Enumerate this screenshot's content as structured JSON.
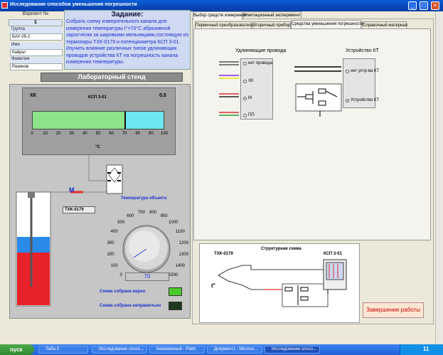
{
  "window": {
    "title": "Исследование способов уменьшения погрешности"
  },
  "student": {
    "variant_label": "Вариант №",
    "variant_value": "1",
    "group_label": "Группа",
    "group_value": "БАУ-05-2",
    "name_label": "Имя",
    "name_value": "Кайрат",
    "surname_label": "Фамилия",
    "surname_value": "Разинов"
  },
  "task": {
    "title": "Задание:",
    "text": "Собрать схему измерительного канала для измерения температуры t°=70°C абразивной заросчески за шаровыми мельницами,состоящую из термопары ТХК-0179 и потенциометра КСП 3-01. Изучить влияние различных типов удлиняющих проводов устройства КТ на погрешность канала измерения температуры."
  },
  "lab": {
    "title": "Лабораторный стенд",
    "meter_type": "ХК",
    "meter_model": "КСП 3-01",
    "meter_class": "0,5",
    "unit": "°C",
    "ticks": [
      "0",
      "10",
      "20",
      "30",
      "40",
      "50",
      "60",
      "70",
      "80",
      "90",
      "100"
    ],
    "progress_pct": 0.7,
    "sensor_tag": "ТХК-0179",
    "wire_tag": "М",
    "object_temp_label": "Температура объекта",
    "dial_ticks": [
      "0",
      "100",
      "200",
      "300",
      "400",
      "500",
      "600",
      "700",
      "800",
      "900",
      "1000",
      "1100",
      "1200",
      "1300",
      "1400",
      "1500"
    ],
    "dial_value": "70",
    "led_ok_label": "Схема собрана верно",
    "led_bad_label": "Схема собрана неправильно"
  },
  "tabs_top": [
    "Выбор средств измерения",
    "Имитационный эксперимент"
  ],
  "tabs_inner": [
    "Первичный преобразователь",
    "Вторичный прибор",
    "Средства уменьшения погрешности",
    "Справочный материал"
  ],
  "wires": {
    "title": "Удлиняющие провода",
    "options": [
      {
        "label": "нет провода",
        "selected": false
      },
      {
        "label": "ХК",
        "selected": false
      },
      {
        "label": "М",
        "selected": true
      },
      {
        "label": "ПП",
        "selected": false
      }
    ]
  },
  "kt": {
    "title": "Устройство КТ",
    "options": [
      {
        "label": "нет устр-ва КТ",
        "selected": false
      },
      {
        "label": "Устройство КТ",
        "selected": true
      }
    ]
  },
  "scheme": {
    "title": "Структурная схема",
    "left": "ТХК-0179",
    "right": "КСП 3-01",
    "t_mark": "t°"
  },
  "finish_button": "Завершение работы",
  "taskbar": {
    "start": "пуск",
    "items": [
      "Лаба 3",
      "Исследование спосо...",
      "Безымянный - Paint",
      "Документ1 - Microso...",
      "Исследование спосо..."
    ],
    "clock": "11"
  },
  "colors": {
    "accent": "#0a5fd8",
    "bar_fill": "#8be38a",
    "bar_bg": "#6de6f0",
    "led_ok": "#4ccc2c",
    "liquid_hot": "#e8222a",
    "liquid_cold": "#2a8ae8"
  }
}
